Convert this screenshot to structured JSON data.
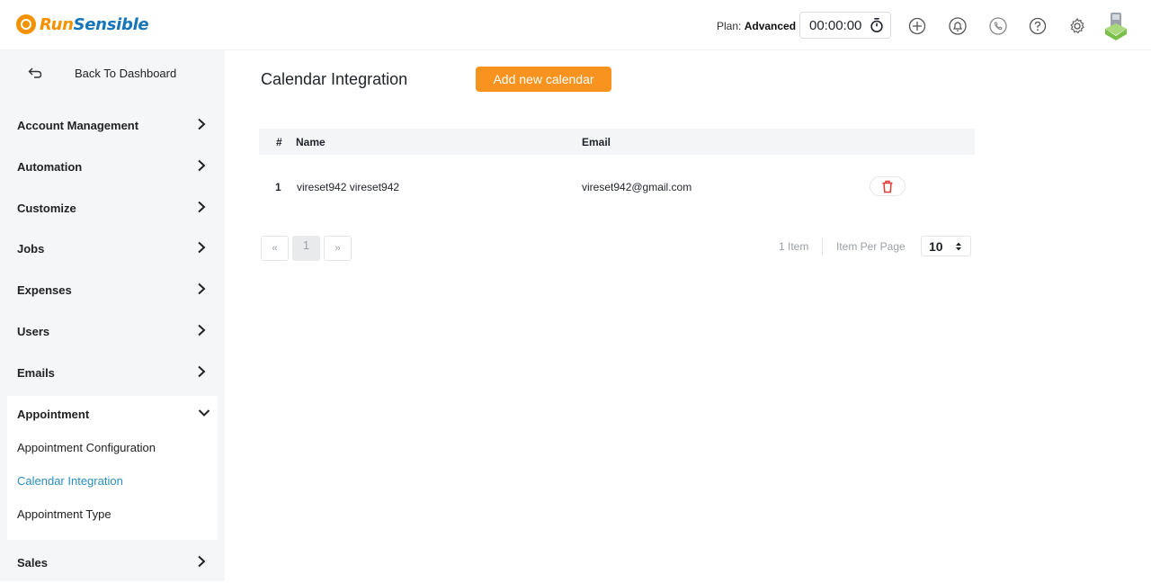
{
  "brand": {
    "name_part1": "Run",
    "name_part2": "Sensible",
    "logo_icon": "runsensible-logo-icon",
    "primary_color": "#f39200",
    "secondary_color": "#1675b8"
  },
  "header": {
    "plan_label": "Plan:",
    "plan_value": "Advanced",
    "timer_value": "00:00:00",
    "icons": [
      "stopwatch-icon",
      "add-ticket-icon",
      "notification-bell-icon",
      "phone-icon",
      "help-icon",
      "settings-gear-icon",
      "user-avatar"
    ]
  },
  "sidebar": {
    "back_label": "Back To Dashboard",
    "items": [
      {
        "label": "Account Management"
      },
      {
        "label": "Automation"
      },
      {
        "label": "Customize"
      },
      {
        "label": "Jobs"
      },
      {
        "label": "Expenses"
      },
      {
        "label": "Users"
      },
      {
        "label": "Emails"
      }
    ],
    "expanded": {
      "label": "Appointment",
      "sub_items": [
        {
          "label": "Appointment Configuration"
        },
        {
          "label": "Calendar Integration"
        },
        {
          "label": "Appointment Type"
        }
      ],
      "active_sub": "Calendar Integration"
    },
    "after_items": [
      {
        "label": "Sales"
      }
    ],
    "active_color": "#2a8fbf"
  },
  "main": {
    "title": "Calendar Integration",
    "add_button_label": "Add new calendar",
    "add_button_color": "#f7931e",
    "table": {
      "headers": {
        "index": "#",
        "name": "Name",
        "email": "Email"
      },
      "rows": [
        {
          "index": "1",
          "name": "vireset942 vireset942",
          "email": "vireset942@gmail.com",
          "action_icon": "trash-icon"
        }
      ]
    },
    "pagination": {
      "prev_label": "«",
      "current_page": "1",
      "next_label": "»",
      "items_count": "1 Item",
      "per_page_label": "Item Per Page",
      "per_page_value": "10"
    }
  }
}
